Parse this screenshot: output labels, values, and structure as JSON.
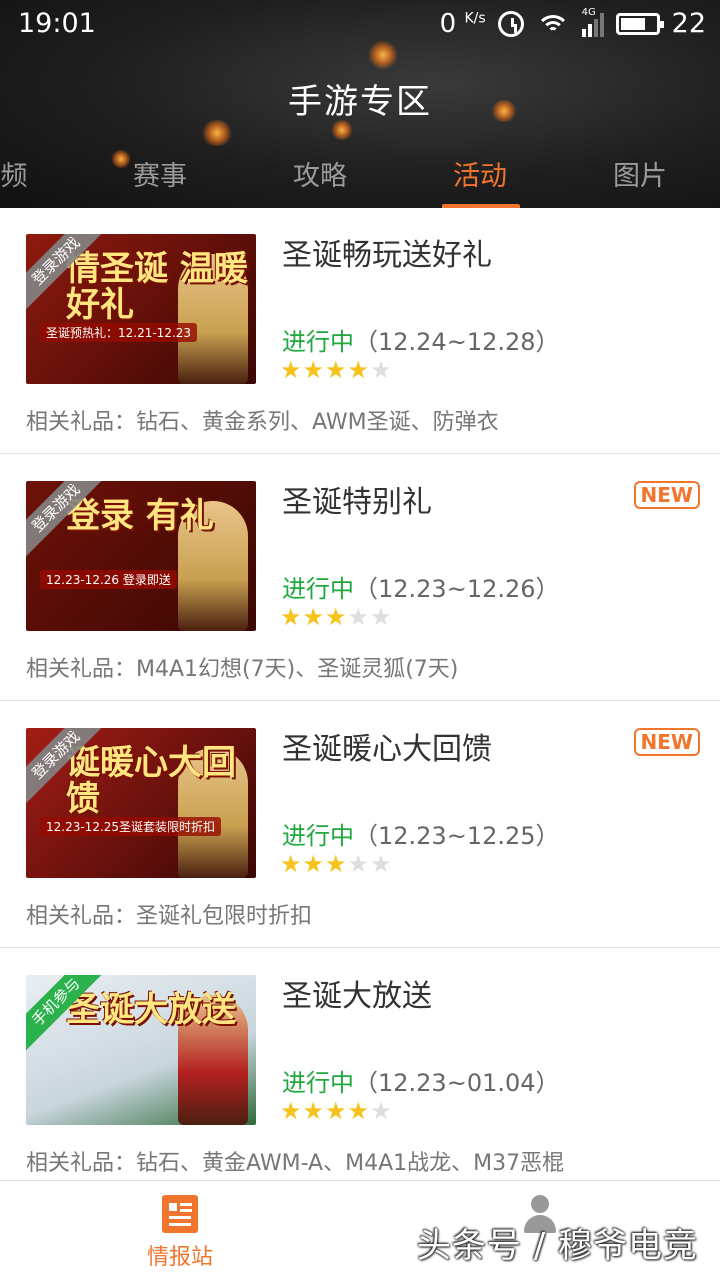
{
  "status_bar": {
    "time": "19:01",
    "net_speed": "0",
    "net_unit": "K/s",
    "network_type": "4G",
    "battery": "22"
  },
  "header": {
    "title": "手游专区"
  },
  "tabs": [
    {
      "label": "频",
      "active": false
    },
    {
      "label": "赛事",
      "active": false
    },
    {
      "label": "攻略",
      "active": false
    },
    {
      "label": "活动",
      "active": true
    },
    {
      "label": "图片",
      "active": false
    }
  ],
  "events": [
    {
      "title": "圣诞畅玩送好礼",
      "status": "进行中",
      "dates": "（12.24~12.28）",
      "rating": 4,
      "max_rating": 5,
      "is_new": false,
      "gifts": "相关礼品：钻石、黄金系列、AWM圣诞、防弹衣",
      "thumb": {
        "ribbon": "登录游戏",
        "ribbon_color": "gray",
        "headline": "情圣诞 温暖好礼",
        "caption": "圣诞预热礼：12.21-12.23",
        "bg": "#8f1a0e"
      }
    },
    {
      "title": "圣诞特别礼",
      "status": "进行中",
      "dates": "（12.23~12.26）",
      "rating": 3,
      "max_rating": 5,
      "is_new": true,
      "gifts": "相关礼品：M4A1幻想(7天)、圣诞灵狐(7天)",
      "thumb": {
        "ribbon": "登录游戏",
        "ribbon_color": "gray",
        "headline": "登录 有礼",
        "caption": "12.23-12.26 登录即送",
        "bg": "#6e1208"
      }
    },
    {
      "title": "圣诞暖心大回馈",
      "status": "进行中",
      "dates": "（12.23~12.25）",
      "rating": 3,
      "max_rating": 5,
      "is_new": true,
      "gifts": "相关礼品：圣诞礼包限时折扣",
      "thumb": {
        "ribbon": "登录游戏",
        "ribbon_color": "gray",
        "headline": "诞暖心大回馈",
        "caption": "12.23-12.25圣诞套装限时折扣",
        "bg": "#a31d16"
      }
    },
    {
      "title": "圣诞大放送",
      "status": "进行中",
      "dates": "（12.23~01.04）",
      "rating": 4,
      "max_rating": 5,
      "is_new": false,
      "gifts": "相关礼品：钻石、黄金AWM-A、M4A1战龙、M37恶棍",
      "thumb": {
        "ribbon": "手机参与",
        "ribbon_color": "green",
        "headline": "圣诞大放送",
        "caption": "",
        "bg": "#c9d6de"
      }
    }
  ],
  "new_badge_label": "NEW",
  "bottom_nav": [
    {
      "label": "情报站",
      "icon": "news-icon",
      "active": true
    },
    {
      "label": "",
      "icon": "person-icon",
      "active": false
    }
  ],
  "watermark": "头条号 / 穆爷电竞",
  "colors": {
    "accent": "#f2752d",
    "status_green": "#1fa83e",
    "star": "#f6c21c",
    "ribbon_green": "#2bb24c"
  }
}
